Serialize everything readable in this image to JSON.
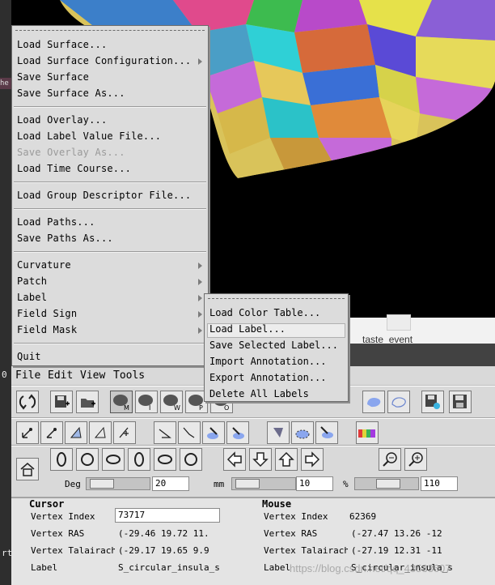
{
  "window": {
    "menubar": [
      "File",
      "Edit",
      "View",
      "Tools"
    ]
  },
  "file_menu": {
    "groups": [
      [
        {
          "label": "Load Surface...",
          "submenu": false,
          "enabled": true
        },
        {
          "label": "Load Surface Configuration...",
          "submenu": true,
          "enabled": true
        },
        {
          "label": "Save Surface",
          "submenu": false,
          "enabled": true
        },
        {
          "label": "Save Surface As...",
          "submenu": false,
          "enabled": true
        }
      ],
      [
        {
          "label": "Load Overlay...",
          "submenu": false,
          "enabled": true
        },
        {
          "label": "Load Label Value File...",
          "submenu": false,
          "enabled": true
        },
        {
          "label": "Save Overlay As...",
          "submenu": false,
          "enabled": false
        },
        {
          "label": "Load Time Course...",
          "submenu": false,
          "enabled": true
        }
      ],
      [
        {
          "label": "Load Group Descriptor File...",
          "submenu": false,
          "enabled": true
        }
      ],
      [
        {
          "label": "Load Paths...",
          "submenu": false,
          "enabled": true
        },
        {
          "label": "Save Paths As...",
          "submenu": false,
          "enabled": true
        }
      ],
      [
        {
          "label": "Curvature",
          "submenu": true,
          "enabled": true
        },
        {
          "label": "Patch",
          "submenu": true,
          "enabled": true
        },
        {
          "label": "Label",
          "submenu": true,
          "enabled": true
        },
        {
          "label": "Field Sign",
          "submenu": true,
          "enabled": true
        },
        {
          "label": "Field Mask",
          "submenu": true,
          "enabled": true
        }
      ],
      [
        {
          "label": "Quit",
          "submenu": false,
          "enabled": true
        }
      ]
    ]
  },
  "label_submenu": {
    "items": [
      "Load Color Table...",
      "Load Label...",
      "Save Selected Label...",
      "Import Annotation...",
      "Export Annotation...",
      "Delete All Labels"
    ],
    "highlighted": "Load Label..."
  },
  "toolbar": {
    "surface_buttons": [
      "M",
      "I",
      "W",
      "P",
      "O"
    ]
  },
  "transform": {
    "deg_label": "Deg",
    "deg_value": "20",
    "mm_label": "mm",
    "mm_value": "10",
    "pct_label": "%",
    "pct_value": "110"
  },
  "info": {
    "cursor": {
      "heading": "Cursor",
      "rows": [
        {
          "label": "Vertex Index",
          "value": "73717",
          "editable": true
        },
        {
          "label": "Vertex RAS",
          "value": "(-29.46  19.72  11."
        },
        {
          "label": "Vertex Talairach",
          "value": "(-29.17  19.65  9.9"
        },
        {
          "label": "Label",
          "value": "S_circular_insula_s"
        }
      ]
    },
    "mouse": {
      "heading": "Mouse",
      "rows": [
        {
          "label": "Vertex Index",
          "value": "62369"
        },
        {
          "label": "Vertex RAS",
          "value": "(-27.47  13.26  -12"
        },
        {
          "label": "Vertex Talairach",
          "value": "(-27.19  12.31  -11"
        },
        {
          "label": "Label",
          "value": "S_circular_insula_s"
        }
      ]
    }
  },
  "desktop": {
    "icon_label": "taste_event"
  },
  "watermark": "https://blog.csdn.net/qq_43533607",
  "colors": {
    "menu_bg": "#dcdcdc",
    "viewer_bg": "#000000",
    "titlebar": "#424242"
  }
}
